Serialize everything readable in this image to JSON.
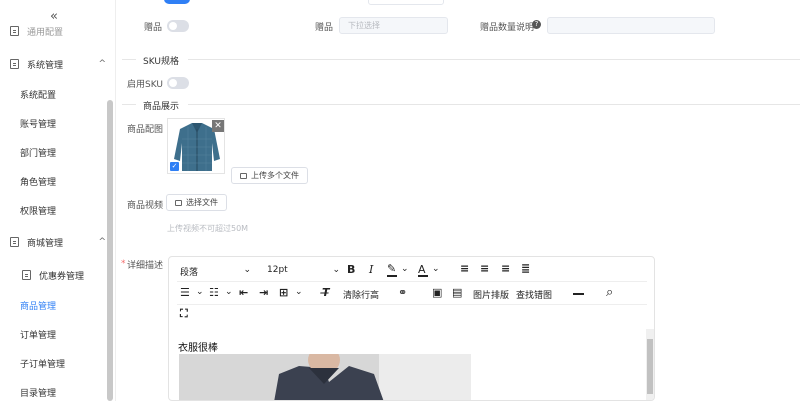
{
  "sidebar": {
    "collapse_glyph": "«",
    "top_cut_item": "通用配置",
    "items": [
      {
        "label": "系统管理",
        "icon": "document-icon",
        "arrow": "^"
      },
      {
        "label": "系统配置"
      },
      {
        "label": "账号管理"
      },
      {
        "label": "部门管理"
      },
      {
        "label": "角色管理"
      },
      {
        "label": "权限管理"
      },
      {
        "label": "商城管理",
        "icon": "document-icon",
        "arrow": "^"
      },
      {
        "label": "优惠券管理",
        "icon": "document-icon",
        "arrow": "^"
      },
      {
        "label": "商品管理",
        "active": true
      },
      {
        "label": "订单管理"
      },
      {
        "label": "子订单管理"
      },
      {
        "label": "目录管理"
      }
    ]
  },
  "form": {
    "gift_label": "赠品",
    "gift_select_label": "赠品",
    "gift_select_placeholder": "下拉选择",
    "gift_qty_label": "赠品数量说明",
    "sku_section": "SKU规格",
    "enable_sku_label": "启用SKU",
    "display_section": "商品展示",
    "image_label": "商品配图",
    "upload_multi_label": "上传多个文件",
    "video_label": "商品视频",
    "choose_file_label": "选择文件",
    "video_hint": "上传视频不可超过50M",
    "desc_required": "*",
    "desc_label": "详细描述"
  },
  "editor": {
    "paragraph_select": "段落",
    "fontsize_select": "12pt",
    "clear_format": "清除行高",
    "image_layout": "图片排版",
    "find_image": "查找错图",
    "content_text": "衣服很棒"
  },
  "colors": {
    "accent": "#2f7ff5",
    "required": "#f56c6c"
  }
}
